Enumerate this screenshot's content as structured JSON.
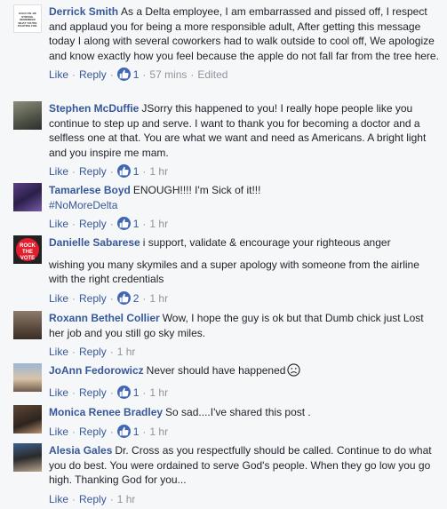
{
  "comments": [
    {
      "author": "Derrick Smith",
      "text": "As a Delta employee, I am embarrassed and pissed off, I respect and applaud you for being a more responsible adult, After getting this message today I along with several coworkers had to walk outside to cool off, We apologize and know exactly how you feel because the apple do not fall far from the tree here.",
      "like_label": "Like",
      "reply_label": "Reply",
      "like_count": "1",
      "time": "57 mins",
      "edited": "Edited",
      "avatar_text": "HOLD ON. BE STRONG. REMEMBER WHAT YOU'RE FIGHTING FOR."
    },
    {
      "author": "Stephen McDuffie",
      "text": "JSorry this happened to you! I really hope people like you continue to step up and serve. I want to thank you for becoming a doctor and a selfless one at that. You are what we want and need as Americans. A bright light and you inspire me mam.",
      "like_label": "Like",
      "reply_label": "Reply",
      "like_count": "1",
      "time": "1 hr"
    },
    {
      "author": "Tamarlese Boyd",
      "text": "ENOUGH!!!! I'm Sick of it!!!",
      "hashtag": "#NoMoreDelta",
      "like_label": "Like",
      "reply_label": "Reply",
      "like_count": "1",
      "time": "1 hr"
    },
    {
      "author": "Danielle Sabarese",
      "text": "i support, validate & encourage your righteous anger",
      "text2": "wishing you many skymiles and a super apology with someone from the airline with the right credentials",
      "like_label": "Like",
      "reply_label": "Reply",
      "like_count": "2",
      "time": "1 hr",
      "avatar_text": "ROCK THE VOTE"
    },
    {
      "author": "Roxann Bethel Collier",
      "text": "Wow, I hope the guy is ok but that Dumb chick just Lost her job and you still go sky miles.",
      "like_label": "Like",
      "reply_label": "Reply",
      "time": "1 hr"
    },
    {
      "author": "JoAnn Fedorowicz",
      "text": "Never should have happened",
      "like_label": "Like",
      "reply_label": "Reply",
      "like_count": "1",
      "time": "1 hr"
    },
    {
      "author": "Monica Renee Bradley",
      "text": "So sad....I've shared this post .",
      "like_label": "Like",
      "reply_label": "Reply",
      "like_count": "1",
      "time": "1 hr"
    },
    {
      "author": "Alesia Gales",
      "text": "Dr. Cross as you respectfully should be called. Continue to do what you do best. You were ordained to serve God's people. When they go low you go high. Thanking God for you...",
      "like_label": "Like",
      "reply_label": "Reply",
      "time": "1 hr"
    }
  ],
  "colors": {
    "link": "#365899",
    "meta": "#90949c",
    "text": "#1d2129",
    "background": "#f6f7f9",
    "like_badge": "#4267b2"
  },
  "icons": {
    "like": "thumbs-up-icon",
    "emoji": "sad-face-icon"
  }
}
